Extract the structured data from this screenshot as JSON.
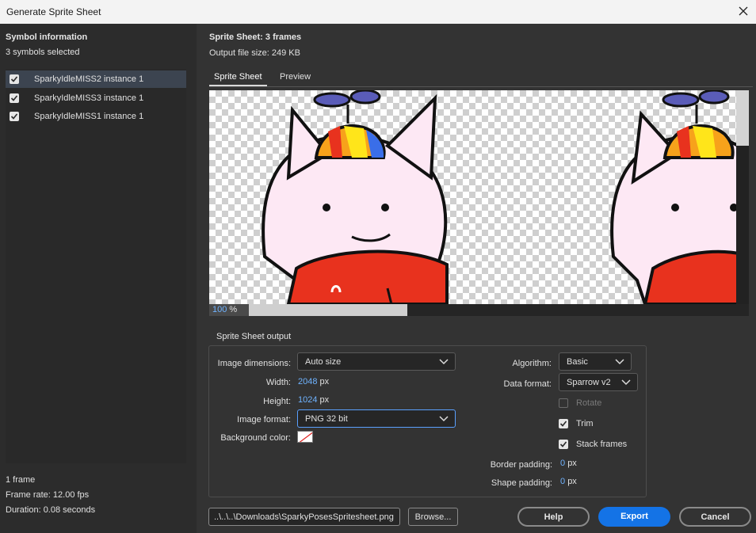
{
  "window": {
    "title": "Generate Sprite Sheet",
    "close_icon": "close-icon"
  },
  "symbols": {
    "header": "Symbol information",
    "selected_count": "3 symbols selected",
    "items": [
      {
        "label": "SparkyIdleMISS2 instance 1",
        "checked": true,
        "selected": true
      },
      {
        "label": "SparkyIdleMISS3 instance 1",
        "checked": true,
        "selected": false
      },
      {
        "label": "SparkyIdleMISS1 instance 1",
        "checked": true,
        "selected": false
      }
    ],
    "frames": "1 frame",
    "frame_rate": "Frame rate: 12.00 fps",
    "duration": "Duration: 0.08 seconds"
  },
  "sheet": {
    "title": "Sprite Sheet: 3 frames",
    "file_size": "Output file size: 249 KB",
    "tabs": [
      {
        "label": "Sprite Sheet",
        "active": true
      },
      {
        "label": "Preview",
        "active": false
      }
    ],
    "zoom_value": "100",
    "zoom_unit": "%"
  },
  "output": {
    "legend": "Sprite Sheet output",
    "image_dimensions_label": "Image dimensions:",
    "image_dimensions_value": "Auto size",
    "width_label": "Width:",
    "width_value": "2048",
    "height_label": "Height:",
    "height_value": "1024",
    "px": "px",
    "image_format_label": "Image format:",
    "image_format_value": "PNG 32 bit",
    "background_label": "Background color:",
    "algorithm_label": "Algorithm:",
    "algorithm_value": "Basic",
    "data_format_label": "Data format:",
    "data_format_value": "Sparrow v2",
    "rotate_label": "Rotate",
    "rotate_checked": false,
    "trim_label": "Trim",
    "trim_checked": true,
    "stack_label": "Stack frames",
    "stack_checked": true,
    "border_padding_label": "Border padding:",
    "border_padding_value": "0",
    "shape_padding_label": "Shape padding:",
    "shape_padding_value": "0"
  },
  "footer": {
    "path": "..\\..\\..\\Downloads\\SparkyPosesSpritesheet.png",
    "browse": "Browse...",
    "help": "Help",
    "export": "Export",
    "cancel": "Cancel"
  },
  "colors": {
    "accent": "#1473e6",
    "value_blue": "#6fb3ff",
    "panel": "#333333"
  }
}
